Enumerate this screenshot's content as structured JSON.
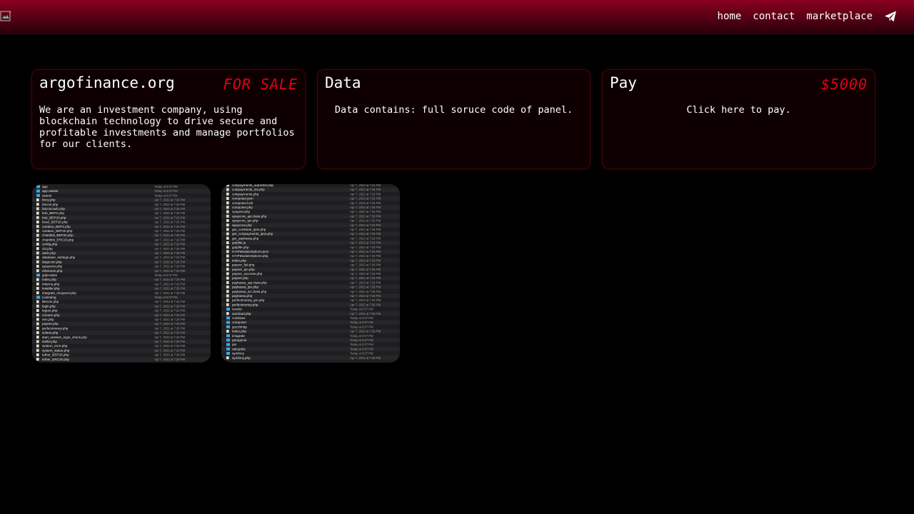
{
  "nav": {
    "links": [
      "home",
      "contact",
      "marketplace"
    ],
    "telegram_icon": "paper-plane-icon"
  },
  "cards": [
    {
      "title": "argofinance.org",
      "tag": "FOR SALE",
      "text": "We are an investment company, using blockchain technology to drive secure and profitable investments and manage portfolios for our clients."
    },
    {
      "title": "Data",
      "text": "Data contains: full soruce code of panel."
    },
    {
      "title": "Pay",
      "tag": "$5000",
      "text": "Click here to pay."
    }
  ],
  "colors": {
    "accent": "#e0001a",
    "nav_gradient_top": "#8a0020",
    "card_bg": "#0e0000"
  },
  "screenshot_1": {
    "rows": [
      {
        "name": "app",
        "date": "Today at 5:07 PM",
        "folder": true
      },
      {
        "name": "app-assets",
        "date": "Today at 5:07 PM",
        "folder": true
      },
      {
        "name": "assets",
        "date": "Today at 5:07 PM",
        "folder": true
      },
      {
        "name": "bnny.php",
        "date": "Apr 7, 2022 at 7:26 PM"
      },
      {
        "name": "bitcoin.php",
        "date": "Apr 7, 2022 at 7:26 PM"
      },
      {
        "name": "bitcoincash.php",
        "date": "Apr 7, 2022 at 7:26 PM"
      },
      {
        "name": "bnb_BEP2.php",
        "date": "Apr 7, 2022 at 7:26 PM"
      },
      {
        "name": "bnb_BEP20.php",
        "date": "Apr 7, 2022 at 7:26 PM"
      },
      {
        "name": "busd_BEP20.php",
        "date": "Apr 7, 2022 at 7:26 PM"
      },
      {
        "name": "cardano_BEP2.php",
        "date": "Apr 7, 2022 at 7:26 PM"
      },
      {
        "name": "cardano_BEP20.php",
        "date": "Apr 7, 2022 at 7:26 PM"
      },
      {
        "name": "chainlink_BEP20.php",
        "date": "Apr 7, 2022 at 7:26 PM"
      },
      {
        "name": "chainlink_ERC20.php",
        "date": "Apr 7, 2022 at 7:26 PM"
      },
      {
        "name": "config.php",
        "date": "Apr 7, 2022 at 7:26 PM"
      },
      {
        "name": "cbl.php",
        "date": "Apr 7, 2022 at 7:26 PM"
      },
      {
        "name": "dash.php",
        "date": "Apr 7, 2022 at 7:26 PM"
      },
      {
        "name": "database_settings.php",
        "date": "Apr 7, 2022 at 7:26 PM"
      },
      {
        "name": "dogecoin.php",
        "date": "Apr 7, 2022 at 7:26 PM"
      },
      {
        "name": "epayeore.php",
        "date": "Apr 7, 2022 at 7:26 PM"
      },
      {
        "name": "ethereum.php",
        "date": "Apr 7, 2022 at 7:26 PM"
      },
      {
        "name": "gulp-tasks",
        "date": "Today at 5:07 PM",
        "folder": true
      },
      {
        "name": "index.php",
        "date": "Apr 7, 2022 at 7:26 PM"
      },
      {
        "name": "infarma.php",
        "date": "Apr 7, 2022 at 7:26 PM"
      },
      {
        "name": "installer.php",
        "date": "Apr 7, 2022 at 7:26 PM"
      },
      {
        "name": "integrate_mixpanel.php",
        "date": "Apr 7, 2022 at 7:26 PM"
      },
      {
        "name": "Licensing",
        "date": "Today at 5:07 PM",
        "folder": true
      },
      {
        "name": "litecoin.php",
        "date": "Apr 7, 2022 at 7:26 PM"
      },
      {
        "name": "login.php",
        "date": "Apr 7, 2022 at 7:26 PM"
      },
      {
        "name": "logout.php",
        "date": "Apr 7, 2022 at 7:26 PM"
      },
      {
        "name": "monero.php",
        "date": "Apr 7, 2022 at 7:26 PM"
      },
      {
        "name": "neo.php",
        "date": "Apr 7, 2022 at 7:26 PM"
      },
      {
        "name": "payeer.php",
        "date": "Apr 7, 2022 at 7:26 PM"
      },
      {
        "name": "perfectmoney.php",
        "date": "Apr 7, 2022 at 7:26 PM"
      },
      {
        "name": "solana.php",
        "date": "Apr 7, 2022 at 7:26 PM"
      },
      {
        "name": "start_session_login_check.php",
        "date": "Apr 7, 2022 at 7:26 PM"
      },
      {
        "name": "stellar.php",
        "date": "Apr 7, 2022 at 7:26 PM"
      },
      {
        "name": "system_error.php",
        "date": "Apr 7, 2022 at 7:26 PM"
      },
      {
        "name": "system_status.php",
        "date": "Apr 7, 2022 at 7:26 PM"
      },
      {
        "name": "tether_BEP20.php",
        "date": "Apr 7, 2022 at 7:26 PM"
      },
      {
        "name": "tether_ERC20.php",
        "date": "Apr 7, 2022 at 7:26 PM"
      }
    ]
  },
  "screenshot_2": {
    "rows": [
      {
        "name": "coinpayments_autorefer.php",
        "date": "Apr 7, 2022 at 7:26 PM"
      },
      {
        "name": "coinpayments_ins.php",
        "date": "Apr 7, 2022 at 7:26 PM"
      },
      {
        "name": "coinpayments.php",
        "date": "Apr 7, 2022 at 7:26 PM"
      },
      {
        "name": "composer.json",
        "date": "Apr 7, 2022 at 7:26 PM"
      },
      {
        "name": "composer.lock",
        "date": "Apr 7, 2022 at 7:26 PM"
      },
      {
        "name": "composer.php",
        "date": "Apr 7, 2022 at 7:26 PM"
      },
      {
        "name": "cpayeer.php",
        "date": "Apr 7, 2022 at 7:26 PM"
      },
      {
        "name": "epaycore_api.class.php",
        "date": "Apr 7, 2022 at 7:26 PM"
      },
      {
        "name": "epaycore_ipn.php",
        "date": "Apr 7, 2022 at 7:26 PM"
      },
      {
        "name": "epaycore.php",
        "date": "Apr 7, 2022 at 7:26 PM"
      },
      {
        "name": "get_coinbase_ipns.php",
        "date": "Apr 7, 2022 at 7:26 PM"
      },
      {
        "name": "get_coinpayments_ipns.php",
        "date": "Apr 7, 2022 at 7:26 PM"
      },
      {
        "name": "get_paykassa.php",
        "date": "Apr 7, 2022 at 7:26 PM"
      },
      {
        "name": "gulpfile.js",
        "date": "Apr 7, 2022 at 7:26 PM"
      },
      {
        "name": "gulpfile.php",
        "date": "Apr 7, 2022 at 7:26 PM"
      },
      {
        "name": "HYIPModuleOptions.json",
        "date": "Apr 7, 2022 at 7:26 PM"
      },
      {
        "name": "HYIPModuleOptions.php",
        "date": "Apr 7, 2022 at 7:26 PM"
      },
      {
        "name": "index.php",
        "date": "Apr 7, 2022 at 7:26 PM"
      },
      {
        "name": "payeer_fail.php",
        "date": "Apr 7, 2022 at 7:26 PM"
      },
      {
        "name": "payeer_ipn.php",
        "date": "Apr 7, 2022 at 7:26 PM"
      },
      {
        "name": "payeer_success.php",
        "date": "Apr 7, 2022 at 7:26 PM"
      },
      {
        "name": "payeer.php",
        "date": "Apr 7, 2022 at 7:26 PM"
      },
      {
        "name": "paykassa_api.class.php",
        "date": "Apr 7, 2022 at 7:26 PM"
      },
      {
        "name": "paykassa_ipn.php",
        "date": "Apr 7, 2022 at 7:26 PM"
      },
      {
        "name": "paykassa_sci.class.php",
        "date": "Apr 7, 2022 at 7:26 PM"
      },
      {
        "name": "paykassa.php",
        "date": "Apr 7, 2022 at 7:26 PM"
      },
      {
        "name": "perfectmoney_ipn.php",
        "date": "Apr 7, 2022 at 7:26 PM"
      },
      {
        "name": "perfectmoney.php",
        "date": "Apr 7, 2022 at 7:26 PM"
      },
      {
        "name": "vendor",
        "date": "Today at 5:07 PM",
        "folder": true
      },
      {
        "name": "autoload.php",
        "date": "Apr 7, 2022 at 7:26 PM"
      },
      {
        "name": "coinbase",
        "date": "Today at 5:07 PM",
        "folder": true
      },
      {
        "name": "composer",
        "date": "Today at 5:07 PM",
        "folder": true
      },
      {
        "name": "guzzlehttp",
        "date": "Today at 5:07 PM",
        "folder": true
      },
      {
        "name": "index.php",
        "date": "Apr 7, 2022 at 7:26 PM"
      },
      {
        "name": "imagrate",
        "date": "Today at 5:07 PM",
        "folder": true
      },
      {
        "name": "paragonie",
        "date": "Today at 5:07 PM",
        "folder": true
      },
      {
        "name": "psr",
        "date": "Today at 5:07 PM",
        "folder": true
      },
      {
        "name": "ralouphie",
        "date": "Today at 5:07 PM",
        "folder": true
      },
      {
        "name": "symfony",
        "date": "Today at 5:07 PM",
        "folder": true
      },
      {
        "name": "symfony.php",
        "date": "Apr 7, 2022 at 7:26 PM"
      }
    ]
  }
}
